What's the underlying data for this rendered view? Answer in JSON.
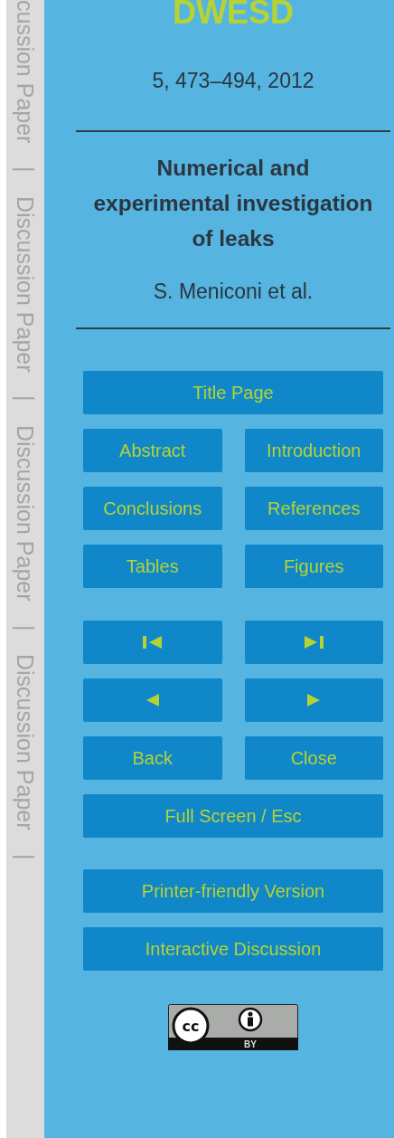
{
  "margin_strip": [
    "cussion Paper",
    "|",
    "Discussion Paper",
    "|",
    "Discussion Paper",
    "|",
    "Discussion Paper",
    "|"
  ],
  "journal": "DWESD",
  "citation": "5, 473–494, 2012",
  "title": "Numerical and experimental investigation of leaks",
  "authors": "S. Meniconi et al.",
  "button_groups": [
    {
      "rows": [
        [
          {
            "kind": "text",
            "label": "Title Page"
          }
        ],
        [
          {
            "kind": "text",
            "label": "Abstract"
          },
          {
            "kind": "text",
            "label": "Introduction"
          }
        ],
        [
          {
            "kind": "text",
            "label": "Conclusions"
          },
          {
            "kind": "text",
            "label": "References"
          }
        ],
        [
          {
            "kind": "text",
            "label": "Tables"
          },
          {
            "kind": "text",
            "label": "Figures"
          }
        ]
      ]
    },
    {
      "rows": [
        [
          {
            "kind": "first"
          },
          {
            "kind": "last"
          }
        ],
        [
          {
            "kind": "prev"
          },
          {
            "kind": "next"
          }
        ],
        [
          {
            "kind": "text",
            "label": "Back"
          },
          {
            "kind": "text",
            "label": "Close"
          }
        ],
        [
          {
            "kind": "text",
            "label": "Full Screen / Esc"
          }
        ]
      ]
    },
    {
      "rows": [
        [
          {
            "kind": "text",
            "label": "Printer-friendly Version"
          }
        ],
        [
          {
            "kind": "text",
            "label": "Interactive Discussion"
          }
        ]
      ]
    }
  ],
  "license": {
    "symbol": "cc",
    "label": "BY"
  }
}
